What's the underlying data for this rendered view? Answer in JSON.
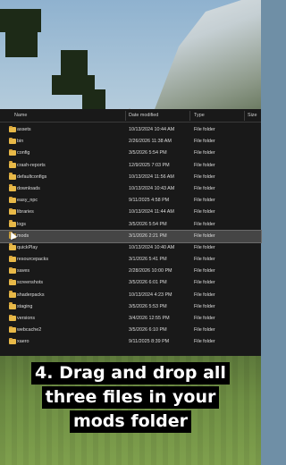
{
  "columns": {
    "name": "Name",
    "date": "Date modified",
    "type": "Type",
    "size": "Size"
  },
  "rows": [
    {
      "name": "assets",
      "date": "10/13/2024 10:44 AM",
      "type": "File folder"
    },
    {
      "name": "bin",
      "date": "2/26/2026 11:38 AM",
      "type": "File folder"
    },
    {
      "name": "config",
      "date": "3/5/2026 5:54 PM",
      "type": "File folder"
    },
    {
      "name": "crash-reports",
      "date": "12/9/2025 7:03 PM",
      "type": "File folder"
    },
    {
      "name": "defaultconfigs",
      "date": "10/13/2024 11:56 AM",
      "type": "File folder"
    },
    {
      "name": "downloads",
      "date": "10/13/2024 10:43 AM",
      "type": "File folder"
    },
    {
      "name": "easy_npc",
      "date": "9/11/2025 4:58 PM",
      "type": "File folder"
    },
    {
      "name": "libraries",
      "date": "10/13/2024 11:44 AM",
      "type": "File folder"
    },
    {
      "name": "logs",
      "date": "3/5/2026 5:54 PM",
      "type": "File folder"
    },
    {
      "name": "mods",
      "date": "3/1/2026 2:21 PM",
      "type": "File folder",
      "selected": true
    },
    {
      "name": "quickPlay",
      "date": "10/13/2024 10:40 AM",
      "type": "File folder"
    },
    {
      "name": "resourcepacks",
      "date": "3/1/2026 5:41 PM",
      "type": "File folder"
    },
    {
      "name": "saves",
      "date": "2/28/2026 10:00 PM",
      "type": "File folder"
    },
    {
      "name": "screenshots",
      "date": "3/5/2026 6:01 PM",
      "type": "File folder"
    },
    {
      "name": "shaderpacks",
      "date": "10/13/2024 4:23 PM",
      "type": "File folder"
    },
    {
      "name": "staging",
      "date": "3/5/2026 5:53 PM",
      "type": "File folder"
    },
    {
      "name": "versions",
      "date": "3/4/2026 12:55 PM",
      "type": "File folder"
    },
    {
      "name": "webcache2",
      "date": "3/5/2026 6:10 PM",
      "type": "File folder"
    },
    {
      "name": "xaero",
      "date": "9/11/2025 8:39 PM",
      "type": "File folder"
    }
  ],
  "caption": [
    "4. Drag and drop all",
    "three files in your",
    "mods folder"
  ],
  "icons": {
    "folder": "folder-icon",
    "cursor": "mouse-cursor-icon",
    "sort": "chevron-up-icon"
  },
  "colors": {
    "folder": "#e8b948",
    "selection": "#454545",
    "explorer_bg": "#191919"
  }
}
